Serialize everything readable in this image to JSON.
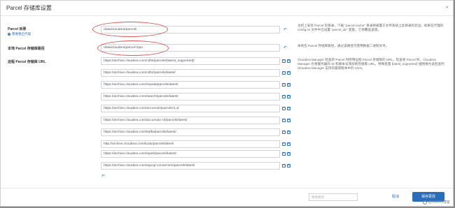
{
  "dialog": {
    "title": "Parcel 存储库设置",
    "close_glyph": "×"
  },
  "parcel_dir": {
    "label": "Parcel 目录",
    "sublink": "需要重启代理",
    "value": "/data/cloudera/parcels",
    "help": "主机上安装 Parcel 的目录。下载 \"parcel-cache\" 目录将被置于文件系统上此目录的旁边。如果在代理的 config.ini 文件中已设置 \"parcel_dir\" 变量，它将覆盖该值。"
  },
  "local_repo": {
    "label": "本地 Parcel 存储库路径",
    "value": "/data/cloudera/parcel-repo",
    "help": "本地包 Parcel 存储库路径，通过该路径可使用数据二进制文件。"
  },
  "remote_urls": {
    "label": "远程 Parcel 存储库 URL",
    "help": "Cloudera Manager 检查新 Parcel 时所用远程 Parcel 存储库的 URL。检查新 Parcel 时，Cloudera Manager 也将服务器的 ID 和版本号添加到存储库 URL。特殊变量 {latest_supported} 被替换为此检查时 Cloudera Manager 支持的最新版本中的 CDH。",
    "items": [
      "https://archive.cloudera.com/cdh5/parcels/{latest_supported}/",
      "https://archive.cloudera.com/cdh4/parcels/latest/",
      "https://archive.cloudera.com/impala/parcels/latest/",
      "https://archive.cloudera.com/search/parcels/latest/",
      "https://archive.cloudera.com/accumulo/parcels/1.4/",
      "https://archive.cloudera.com/accumulo-c5/parcels/latest/",
      "https://archive.cloudera.com/kafka/parcels/latest/",
      "http://archive.cloudera.com/kudu/parcels/latest/",
      "https://archive.cloudera.com/spark/parcels/latest/",
      "https://archive.cloudera.com/sqoop-connectors/parcels/latest/"
    ]
  },
  "icons": {
    "undo": "↶",
    "minus": "−",
    "plus": "+",
    "help": "?"
  },
  "footer": {
    "notes_placeholder": "更改原因",
    "cancel_label": "取消",
    "save_label": "保存更改"
  },
  "watermark": "@51CTO博客"
}
